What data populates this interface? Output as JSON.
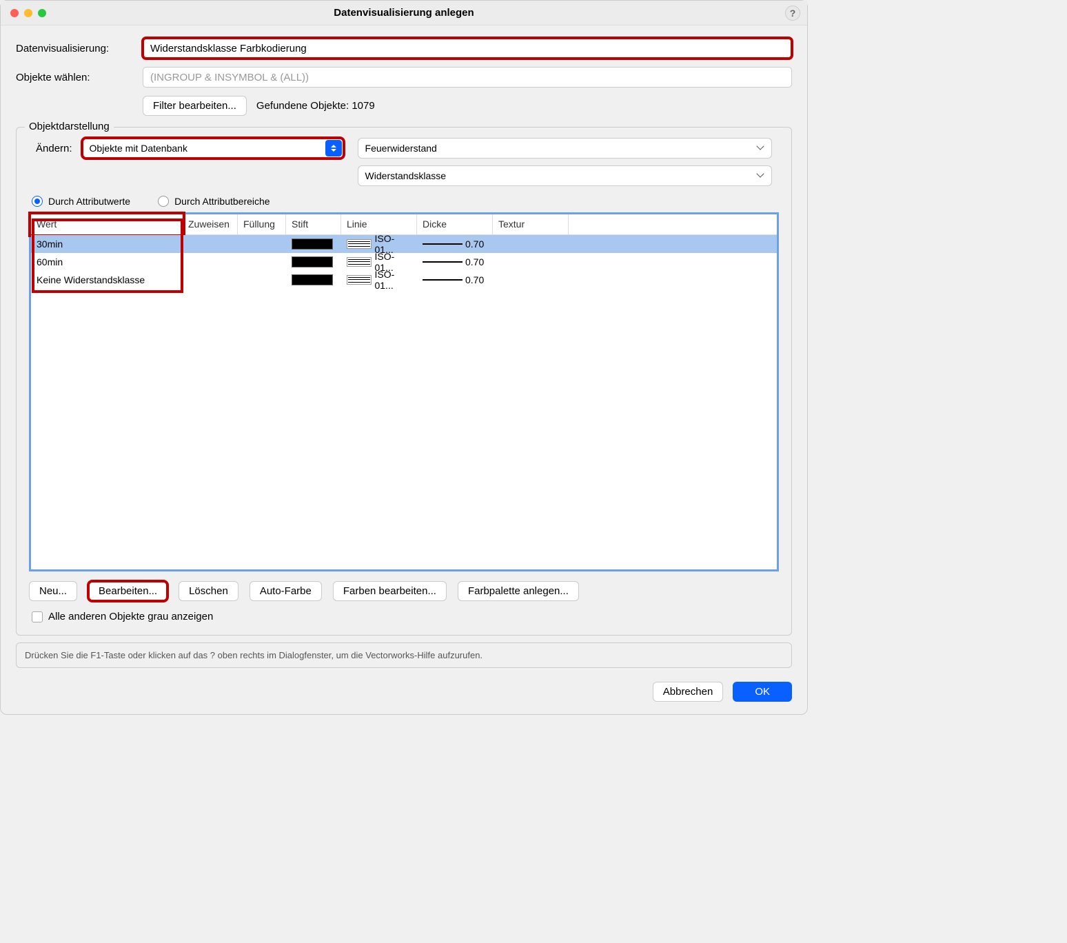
{
  "title": "Datenvisualisierung anlegen",
  "labels": {
    "dv": "Datenvisualisierung:",
    "ow": "Objekte wählen:",
    "filter": "Filter bearbeiten...",
    "found": "Gefundene Objekte: 1079",
    "fs": "Objektdarstellung",
    "aendern": "Ändern:",
    "r1": "Durch Attributwerte",
    "r2": "Durch Attributbereiche",
    "cbx": "Alle anderen Objekte grau anzeigen",
    "hint": "Drücken Sie die F1-Taste oder klicken auf das ? oben rechts im Dialogfenster, um die Vectorworks-Hilfe aufzurufen.",
    "cancel": "Abbrechen",
    "ok": "OK"
  },
  "inputs": {
    "dvVal": "Widerstandsklasse Farbkodierung",
    "owPh": "(INGROUP & INSYMBOL & (ALL))",
    "sel1": "Objekte mit Datenbank",
    "sel2": "Feuerwiderstand",
    "sel3": "Widerstandsklasse"
  },
  "th": [
    "Wert",
    "Zuweisen",
    "Füllung",
    "Stift",
    "Linie",
    "Dicke",
    "Textur"
  ],
  "rows": [
    {
      "w": "30min",
      "l": "ISO-01...",
      "d": "0.70"
    },
    {
      "w": "60min",
      "l": "ISO-01...",
      "d": "0.70"
    },
    {
      "w": "Keine Widerstandsklasse",
      "l": "ISO-01...",
      "d": "0.70"
    }
  ],
  "actions": [
    "Neu...",
    "Bearbeiten...",
    "Löschen",
    "Auto-Farbe",
    "Farben bearbeiten...",
    "Farbpalette anlegen..."
  ]
}
